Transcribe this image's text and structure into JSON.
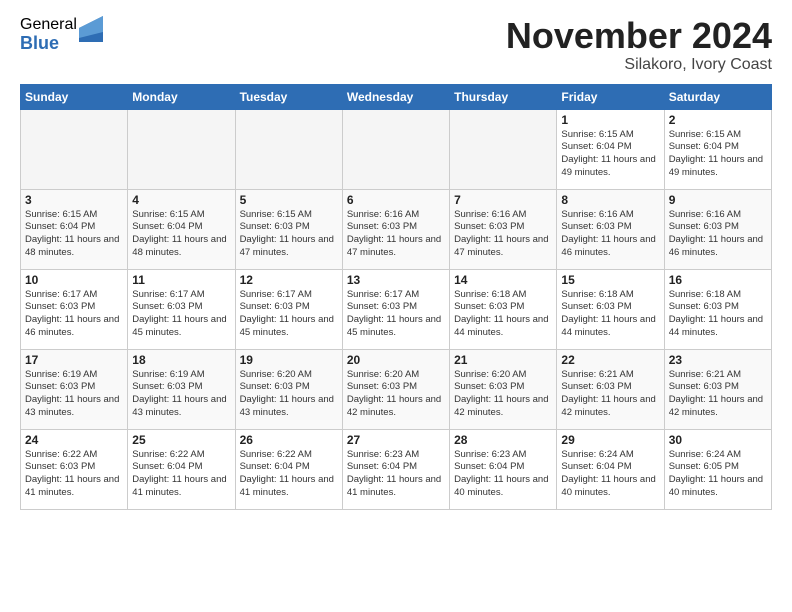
{
  "logo": {
    "general": "General",
    "blue": "Blue"
  },
  "title": "November 2024",
  "subtitle": "Silakoro, Ivory Coast",
  "days_of_week": [
    "Sunday",
    "Monday",
    "Tuesday",
    "Wednesday",
    "Thursday",
    "Friday",
    "Saturday"
  ],
  "weeks": [
    [
      {
        "day": "",
        "info": ""
      },
      {
        "day": "",
        "info": ""
      },
      {
        "day": "",
        "info": ""
      },
      {
        "day": "",
        "info": ""
      },
      {
        "day": "",
        "info": ""
      },
      {
        "day": "1",
        "info": "Sunrise: 6:15 AM\nSunset: 6:04 PM\nDaylight: 11 hours and 49 minutes."
      },
      {
        "day": "2",
        "info": "Sunrise: 6:15 AM\nSunset: 6:04 PM\nDaylight: 11 hours and 49 minutes."
      }
    ],
    [
      {
        "day": "3",
        "info": "Sunrise: 6:15 AM\nSunset: 6:04 PM\nDaylight: 11 hours and 48 minutes."
      },
      {
        "day": "4",
        "info": "Sunrise: 6:15 AM\nSunset: 6:04 PM\nDaylight: 11 hours and 48 minutes."
      },
      {
        "day": "5",
        "info": "Sunrise: 6:15 AM\nSunset: 6:03 PM\nDaylight: 11 hours and 47 minutes."
      },
      {
        "day": "6",
        "info": "Sunrise: 6:16 AM\nSunset: 6:03 PM\nDaylight: 11 hours and 47 minutes."
      },
      {
        "day": "7",
        "info": "Sunrise: 6:16 AM\nSunset: 6:03 PM\nDaylight: 11 hours and 47 minutes."
      },
      {
        "day": "8",
        "info": "Sunrise: 6:16 AM\nSunset: 6:03 PM\nDaylight: 11 hours and 46 minutes."
      },
      {
        "day": "9",
        "info": "Sunrise: 6:16 AM\nSunset: 6:03 PM\nDaylight: 11 hours and 46 minutes."
      }
    ],
    [
      {
        "day": "10",
        "info": "Sunrise: 6:17 AM\nSunset: 6:03 PM\nDaylight: 11 hours and 46 minutes."
      },
      {
        "day": "11",
        "info": "Sunrise: 6:17 AM\nSunset: 6:03 PM\nDaylight: 11 hours and 45 minutes."
      },
      {
        "day": "12",
        "info": "Sunrise: 6:17 AM\nSunset: 6:03 PM\nDaylight: 11 hours and 45 minutes."
      },
      {
        "day": "13",
        "info": "Sunrise: 6:17 AM\nSunset: 6:03 PM\nDaylight: 11 hours and 45 minutes."
      },
      {
        "day": "14",
        "info": "Sunrise: 6:18 AM\nSunset: 6:03 PM\nDaylight: 11 hours and 44 minutes."
      },
      {
        "day": "15",
        "info": "Sunrise: 6:18 AM\nSunset: 6:03 PM\nDaylight: 11 hours and 44 minutes."
      },
      {
        "day": "16",
        "info": "Sunrise: 6:18 AM\nSunset: 6:03 PM\nDaylight: 11 hours and 44 minutes."
      }
    ],
    [
      {
        "day": "17",
        "info": "Sunrise: 6:19 AM\nSunset: 6:03 PM\nDaylight: 11 hours and 43 minutes."
      },
      {
        "day": "18",
        "info": "Sunrise: 6:19 AM\nSunset: 6:03 PM\nDaylight: 11 hours and 43 minutes."
      },
      {
        "day": "19",
        "info": "Sunrise: 6:20 AM\nSunset: 6:03 PM\nDaylight: 11 hours and 43 minutes."
      },
      {
        "day": "20",
        "info": "Sunrise: 6:20 AM\nSunset: 6:03 PM\nDaylight: 11 hours and 42 minutes."
      },
      {
        "day": "21",
        "info": "Sunrise: 6:20 AM\nSunset: 6:03 PM\nDaylight: 11 hours and 42 minutes."
      },
      {
        "day": "22",
        "info": "Sunrise: 6:21 AM\nSunset: 6:03 PM\nDaylight: 11 hours and 42 minutes."
      },
      {
        "day": "23",
        "info": "Sunrise: 6:21 AM\nSunset: 6:03 PM\nDaylight: 11 hours and 42 minutes."
      }
    ],
    [
      {
        "day": "24",
        "info": "Sunrise: 6:22 AM\nSunset: 6:03 PM\nDaylight: 11 hours and 41 minutes."
      },
      {
        "day": "25",
        "info": "Sunrise: 6:22 AM\nSunset: 6:04 PM\nDaylight: 11 hours and 41 minutes."
      },
      {
        "day": "26",
        "info": "Sunrise: 6:22 AM\nSunset: 6:04 PM\nDaylight: 11 hours and 41 minutes."
      },
      {
        "day": "27",
        "info": "Sunrise: 6:23 AM\nSunset: 6:04 PM\nDaylight: 11 hours and 41 minutes."
      },
      {
        "day": "28",
        "info": "Sunrise: 6:23 AM\nSunset: 6:04 PM\nDaylight: 11 hours and 40 minutes."
      },
      {
        "day": "29",
        "info": "Sunrise: 6:24 AM\nSunset: 6:04 PM\nDaylight: 11 hours and 40 minutes."
      },
      {
        "day": "30",
        "info": "Sunrise: 6:24 AM\nSunset: 6:05 PM\nDaylight: 11 hours and 40 minutes."
      }
    ]
  ]
}
